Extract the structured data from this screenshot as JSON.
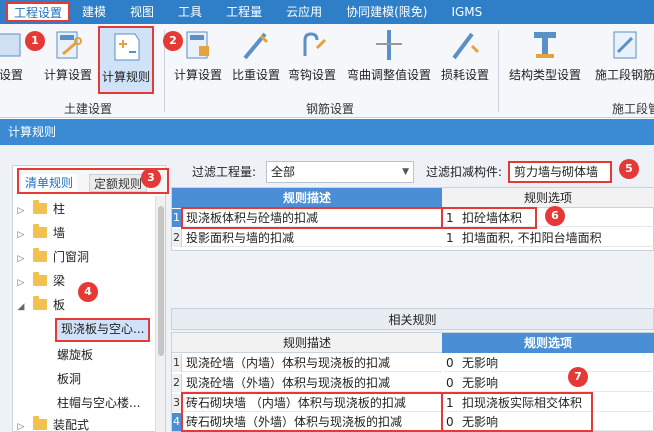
{
  "menu": {
    "items": [
      "工程设置",
      "建模",
      "视图",
      "工具",
      "工程量",
      "云应用",
      "协同建模(限免)",
      "IGMS"
    ]
  },
  "ribbon": {
    "partial_left_label": "设置",
    "buttons": {
      "calc_settings": "计算设置",
      "calc_rules": "计算规则",
      "rebar_calc_settings": "计算设置",
      "weight_settings": "比重设置",
      "hook_settings": "弯钩设置",
      "bend_adjust": "弯曲调整值设置",
      "loss_settings": "损耗设置",
      "struct_type": "结构类型设置",
      "construction_section": "施工段钢筋"
    },
    "groups": {
      "civil": "土建设置",
      "rebar": "钢筋设置",
      "construction": "施工段管"
    }
  },
  "dialog": {
    "title": "计算规则",
    "tabs": [
      "清单规则",
      "定额规则"
    ],
    "tree": {
      "nodes": [
        "柱",
        "墙",
        "门窗洞",
        "梁",
        "板",
        "装配式"
      ],
      "children": [
        "现浇板与空心...",
        "螺旋板",
        "板洞",
        "柱帽与空心楼..."
      ]
    },
    "filter": {
      "quantity_label": "过滤工程量:",
      "quantity_value": "全部",
      "component_label": "过滤扣减构件:",
      "component_value": "剪力墙与砌体墙"
    },
    "rules_table": {
      "headers": [
        "规则描述",
        "规则选项"
      ],
      "rows": [
        {
          "num": "1",
          "desc": "现浇板体积与砼墙的扣减",
          "opt_num": "1",
          "opt": "扣砼墙体积"
        },
        {
          "num": "2",
          "desc": "投影面积与墙的扣减",
          "opt_num": "1",
          "opt": "扣墙面积, 不扣阳台墙面积"
        }
      ]
    },
    "related_title": "相关规则",
    "related_table": {
      "headers": [
        "规则描述",
        "规则选项"
      ],
      "rows": [
        {
          "num": "1",
          "desc": "现浇砼墙（内墙）体积与现浇板的扣减",
          "opt_num": "0",
          "opt": "无影响"
        },
        {
          "num": "2",
          "desc": "现浇砼墙（外墙）体积与现浇板的扣减",
          "opt_num": "0",
          "opt": "无影响"
        },
        {
          "num": "3",
          "desc": "砖石砌块墙 （内墙）体积与现浇板的扣减",
          "opt_num": "1",
          "opt": "扣现浇板实际相交体积"
        },
        {
          "num": "4",
          "desc": "砖石砌块墙（外墙）体积与现浇板的扣减",
          "opt_num": "0",
          "opt": "无影响"
        }
      ]
    }
  },
  "callouts": [
    "1",
    "2",
    "3",
    "4",
    "5",
    "6",
    "7"
  ],
  "colors": {
    "accent_blue": "#2e7fc8",
    "callout_red": "#e53935",
    "header_blue": "#4a8fd6"
  }
}
